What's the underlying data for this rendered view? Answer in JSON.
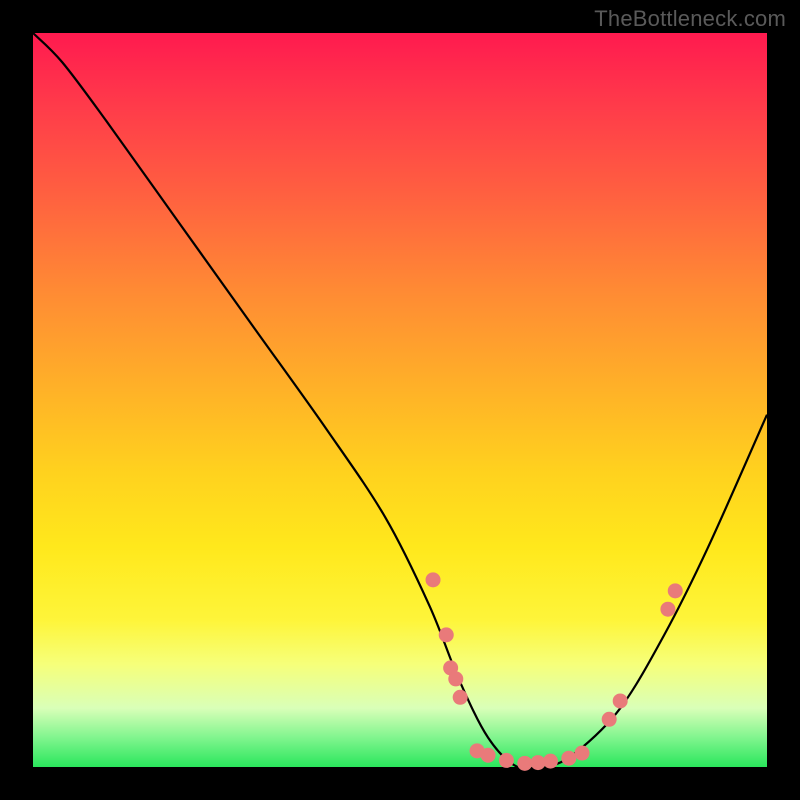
{
  "watermark": "TheBottleneck.com",
  "chart_data": {
    "type": "line",
    "title": "",
    "xlabel": "",
    "ylabel": "",
    "xlim": [
      0,
      100
    ],
    "ylim": [
      0,
      100
    ],
    "grid": false,
    "series": [
      {
        "name": "bottleneck-curve",
        "x": [
          0,
          4,
          10,
          20,
          30,
          40,
          48,
          54,
          58,
          62,
          66,
          70,
          74,
          80,
          86,
          92,
          100
        ],
        "y": [
          100,
          96,
          88,
          74,
          60,
          46,
          34,
          22,
          12,
          4,
          0,
          0,
          2,
          8,
          18,
          30,
          48
        ]
      }
    ],
    "points": [
      {
        "name": "p1",
        "x": 54.5,
        "y": 25.5
      },
      {
        "name": "p2",
        "x": 56.3,
        "y": 18.0
      },
      {
        "name": "p3",
        "x": 56.9,
        "y": 13.5
      },
      {
        "name": "p4",
        "x": 57.6,
        "y": 12.0
      },
      {
        "name": "p5",
        "x": 58.2,
        "y": 9.5
      },
      {
        "name": "p6",
        "x": 60.5,
        "y": 2.2
      },
      {
        "name": "p7",
        "x": 62.0,
        "y": 1.6
      },
      {
        "name": "p8",
        "x": 64.5,
        "y": 0.9
      },
      {
        "name": "p9",
        "x": 67.0,
        "y": 0.5
      },
      {
        "name": "p10",
        "x": 68.8,
        "y": 0.6
      },
      {
        "name": "p11",
        "x": 70.5,
        "y": 0.8
      },
      {
        "name": "p12",
        "x": 73.0,
        "y": 1.2
      },
      {
        "name": "p13",
        "x": 74.8,
        "y": 1.9
      },
      {
        "name": "p14",
        "x": 78.5,
        "y": 6.5
      },
      {
        "name": "p15",
        "x": 80.0,
        "y": 9.0
      },
      {
        "name": "p16",
        "x": 86.5,
        "y": 21.5
      },
      {
        "name": "p17",
        "x": 87.5,
        "y": 24.0
      }
    ],
    "background_gradient": {
      "top": "#ff1a4f",
      "mid": "#ffe81c",
      "bottom": "#2ae65c"
    }
  }
}
